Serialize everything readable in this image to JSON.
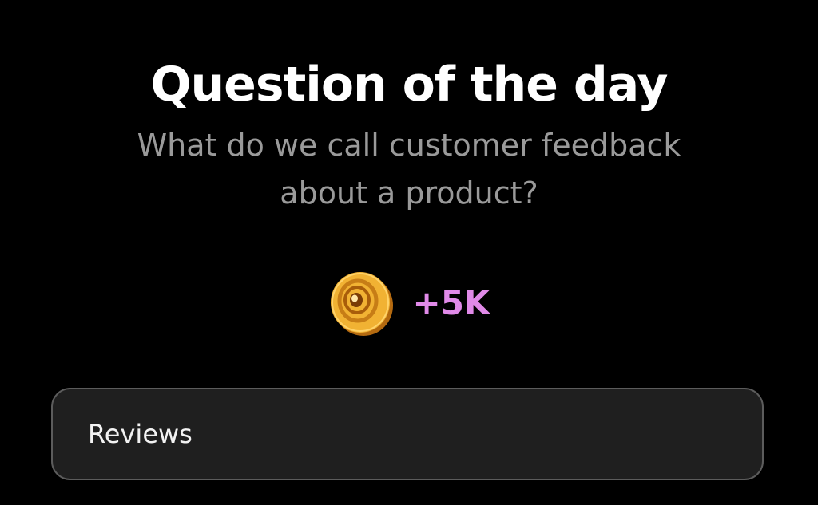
{
  "header": {
    "title": "Question of the day"
  },
  "question": {
    "text": "What do we call customer feedback about a product?"
  },
  "reward": {
    "icon": "coin-icon",
    "amount": "+5K",
    "amount_color": "#e08ae8"
  },
  "answers": [
    {
      "label": "Reviews"
    }
  ],
  "colors": {
    "background": "#000000",
    "title": "#ffffff",
    "question": "#9a9a9a",
    "option_background": "#1f1f1f",
    "option_border": "#5c5c5c",
    "coin": "#f0b030"
  }
}
